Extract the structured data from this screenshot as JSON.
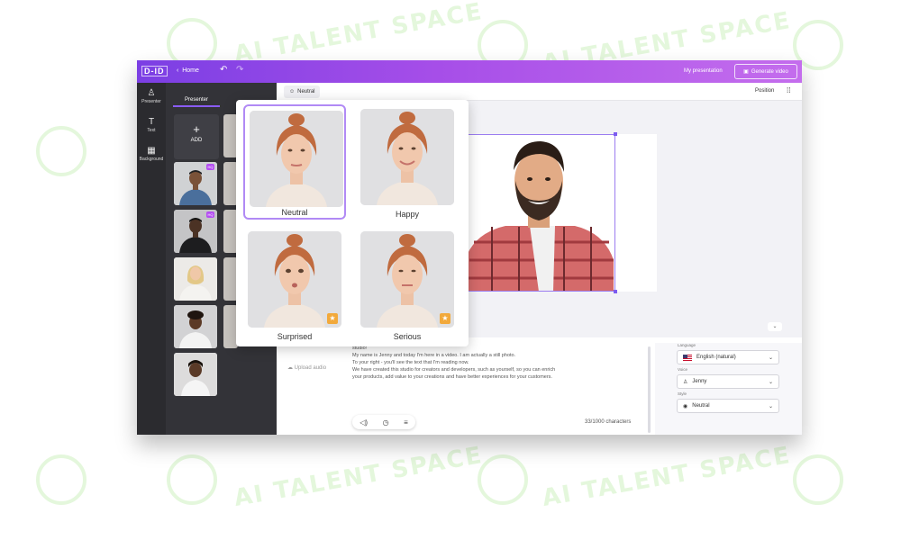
{
  "watermark": {
    "text": "AI TALENT SPACE",
    "color": "#e4f7dc"
  },
  "topbar": {
    "logo": "D-ID",
    "home_label": "Home",
    "undo_icon": "undo-icon",
    "redo_icon": "redo-icon",
    "my_presentation_label": "My presentation",
    "generate_label": "Generate video",
    "gradient_colors": [
      "#7b3fe4",
      "#c46ded"
    ]
  },
  "sidebar": {
    "items": [
      {
        "icon": "person-icon",
        "label": "Presenter"
      },
      {
        "icon": "text-icon",
        "label": "Text"
      },
      {
        "icon": "grid-icon",
        "label": "Background"
      }
    ]
  },
  "panel": {
    "tab_label": "Presenter",
    "add_label": "ADD",
    "presenter_badge": "HQ"
  },
  "toolstrip": {
    "emotion_label": "Neutral",
    "position_label": "Position"
  },
  "emotion_popup": {
    "options": [
      {
        "label": "Neutral",
        "selected": true,
        "premium": false
      },
      {
        "label": "Happy",
        "selected": false,
        "premium": false
      },
      {
        "label": "Surprised",
        "selected": false,
        "premium": true
      },
      {
        "label": "Serious",
        "selected": false,
        "premium": true
      }
    ]
  },
  "script": {
    "lines": [
      "studio!",
      "My name is Jenny and today I'm here in a video. I am actually a still photo.",
      "To your right - you'll see the text that I'm reading now.",
      "We have created this studio for creators and developers, such as yourself, so you can enrich",
      "your products, add value to your creations and have better experiences for your customers."
    ],
    "upload_label": "Upload audio",
    "char_count": "33/1000 characters"
  },
  "settings": {
    "language_label": "Language",
    "language_value": "English (natural)",
    "voice_label": "Voice",
    "voice_value": "Jenny",
    "style_label": "Style",
    "style_value": "Neutral"
  },
  "colors": {
    "accent": "#8a5cf6",
    "premium_star": "#f2a93b",
    "dark_panel": "#333338"
  }
}
